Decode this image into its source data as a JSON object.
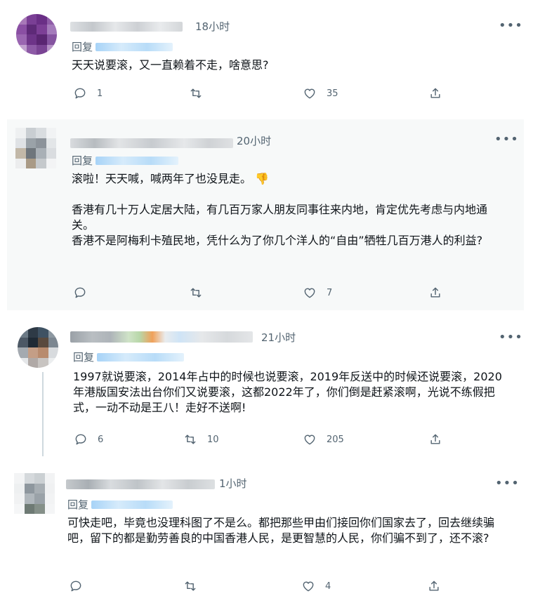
{
  "reply_prefix": "回复",
  "tweets": [
    {
      "time": "18小时",
      "text": [
        "天天说要滚，又一直赖着不走，啥意思?"
      ],
      "actions": {
        "reply": "1",
        "retweet": "",
        "like": "35"
      }
    },
    {
      "time": "20小时",
      "text": [
        "滚啦！天天喊，喊两年了也没見走。",
        "",
        "香港有几十万人定居大陆，有几百万家人朋友同事往来内地，肯定优先考虑与内地通关。",
        "香港不是阿梅利卡殖民地，凭什么为了你几个洋人的“自由”牺牲几百万港人的利益?"
      ],
      "actions": {
        "reply": "",
        "retweet": "",
        "like": "7"
      }
    },
    {
      "time": "21小时",
      "text": [
        "1997就说要滚，2014年占中的时候也说要滚，2019年反送中的时候还说要滚，2020年港版国安法出台你们又说要滚，这都2022年了，你们倒是赶紧滚啊，光说不练假把式，一动不动是王八！走好不送啊!"
      ],
      "actions": {
        "reply": "6",
        "retweet": "10",
        "like": "205"
      }
    },
    {
      "time": "1小时",
      "text": [
        "可快走吧，毕竟也没理科图了不是么。都把那些甲由们接回你们国家去了，回去继续骗吧，留下的都是勤劳善良的中国香港人民，是更智慧的人民，你们骗不到了，还不滚?"
      ],
      "actions": {
        "reply": "",
        "retweet": "",
        "like": "4"
      }
    }
  ],
  "icons": {
    "reply": "reply-icon",
    "retweet": "retweet-icon",
    "like": "heart-icon",
    "share": "share-icon",
    "more": "more-icon",
    "emoji": "thumbs-down-emoji"
  },
  "colors": {
    "secondary_text": "#536471",
    "highlight_bg": "#f7f9f9",
    "thread_line": "#cfd9de",
    "mention_blur": "#a7d3f7"
  }
}
